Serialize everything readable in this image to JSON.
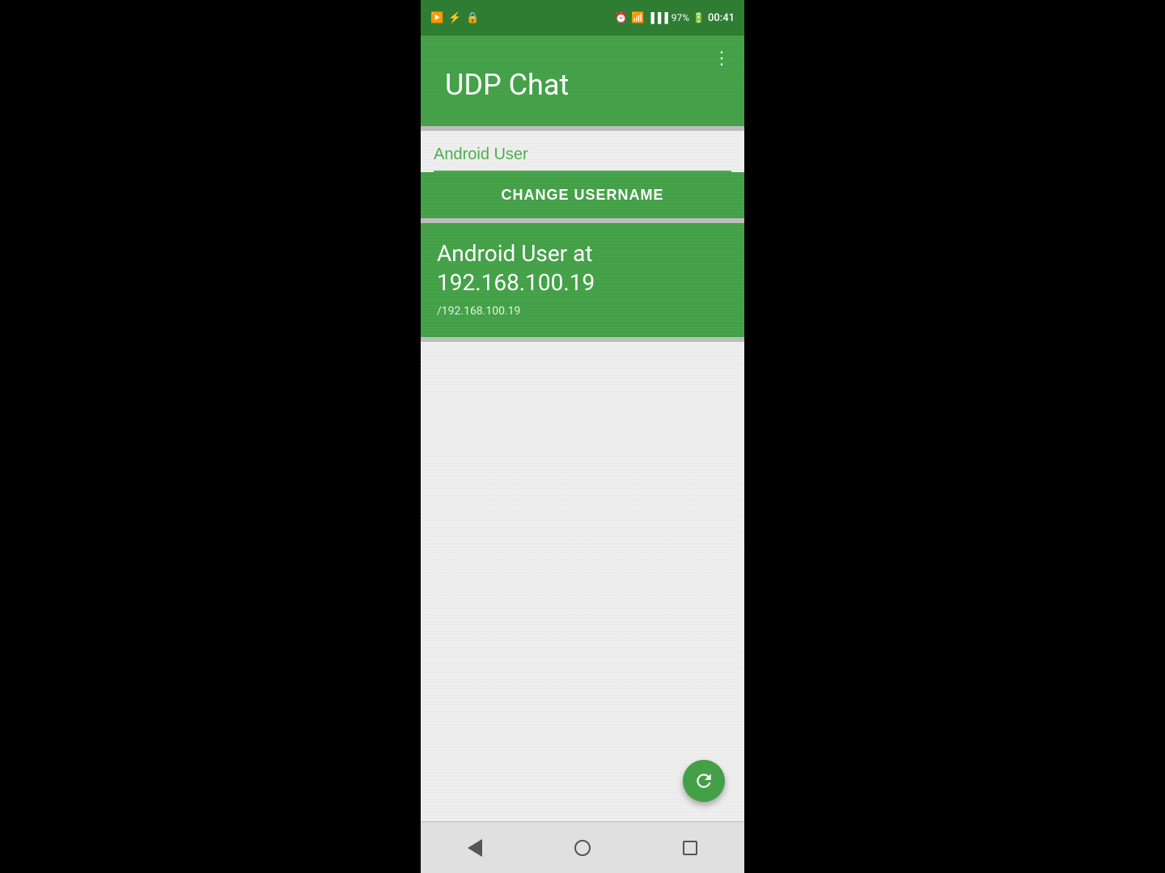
{
  "statusBar": {
    "battery": "97%",
    "time": "00:41",
    "leftIcons": [
      "screen-record-icon",
      "usb-icon",
      "vpn-icon"
    ],
    "rightIcons": [
      "alarm-icon",
      "wifi-icon",
      "signal-icon",
      "battery-icon",
      "time-icon"
    ]
  },
  "header": {
    "title": "UDP Chat",
    "menuLabel": "⋮"
  },
  "usernameSection": {
    "inputValue": "Android User",
    "inputPlaceholder": "Android User"
  },
  "changeUsernameButton": {
    "label": "CHANGE USERNAME"
  },
  "userInfoCard": {
    "displayName": "Android User at 192.168.100.19",
    "ipAddress": "/192.168.100.19"
  },
  "fab": {
    "tooltip": "Refresh"
  },
  "navBar": {
    "back": "Back",
    "home": "Home",
    "recents": "Recents"
  },
  "colors": {
    "green": "#43a047",
    "darkGreen": "#2e7d32",
    "lightGreen": "#4caf50",
    "white": "#ffffff",
    "lightGray": "#eeeeee",
    "divider": "#bdbdbd"
  }
}
